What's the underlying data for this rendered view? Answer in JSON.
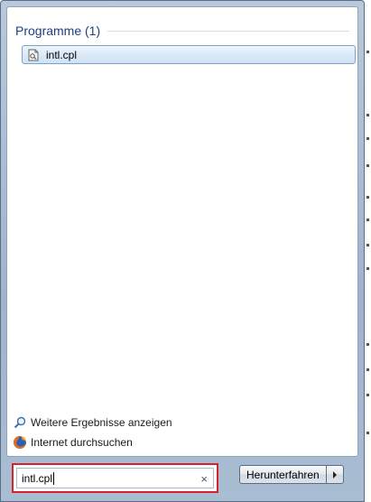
{
  "results": {
    "group_title": "Programme (1)",
    "items": [
      {
        "label": "intl.cpl",
        "icon": "control-panel-file-icon"
      }
    ]
  },
  "links": {
    "more_results": {
      "label": "Weitere Ergebnisse anzeigen",
      "icon": "search-icon"
    },
    "internet_search": {
      "label": "Internet durchsuchen",
      "icon": "firefox-icon"
    }
  },
  "search": {
    "value": "intl.cpl",
    "clear_glyph": "×",
    "highlight_color": "#d6232b"
  },
  "shutdown": {
    "label": "Herunterfahren",
    "arrow_glyph": "▸"
  }
}
